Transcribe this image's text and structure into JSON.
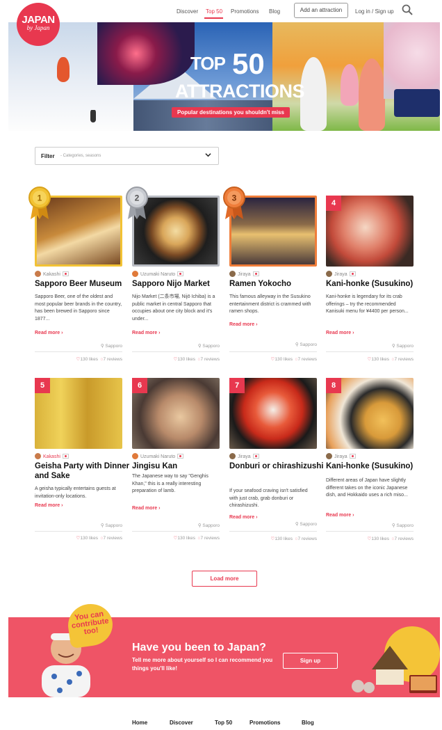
{
  "header": {
    "logo_line1": "JAPAN",
    "logo_line2": "by Japan",
    "nav": [
      "Discover",
      "Top 50",
      "Promotions",
      "Blog"
    ],
    "active_nav": "Top 50",
    "add_attraction": "Add an attraction",
    "login": "Log in / Sign up",
    "search_icon": "search-icon"
  },
  "hero": {
    "title_top": "TOP",
    "title_num": "50",
    "title_main": "ATTRACTIONS",
    "tagline": "Popular destinations you shouldn't miss"
  },
  "filter": {
    "label": "Filter",
    "placeholder": "- Categories, seasons"
  },
  "cards": [
    {
      "rank": "1",
      "author": "Kakashi",
      "title": "Sapporo Beer Museum",
      "desc": "Sapporo Beer, one of the oldest and most popular beer brands in the country, has been brewed in Sapporo since 1877...",
      "more": "Read more",
      "location": "Sapporo",
      "likes": "130 likes",
      "reviews": "7 reviews"
    },
    {
      "rank": "2",
      "author": "Uzumaki Naruto",
      "title": "Sapporo Nijo Market",
      "desc": "Nijo Market (二条市場, Nijō Ichiba) is a public market in central Sapporo that occupies about one city block and it's under...",
      "more": "Read more",
      "location": "Sapporo",
      "likes": "130 likes",
      "reviews": "7 reviews"
    },
    {
      "rank": "3",
      "author": "Jiraya",
      "title": "Ramen Yokocho",
      "desc": "This famous alleyway in the Susukino entertainment district is crammed with ramen shops.",
      "more": "Read more",
      "location": "Sapporo",
      "likes": "130 likes",
      "reviews": "7 reviews"
    },
    {
      "rank": "4",
      "author": "Jiraya",
      "title": "Kani-honke (Susukino)",
      "desc": "Kani-honke is legendary for its crab offerings – try the recommended Kanisuki menu for ¥4400 per person...",
      "more": "Read more",
      "location": "Sapporo",
      "likes": "130 likes",
      "reviews": "7 reviews"
    },
    {
      "rank": "5",
      "author": "Kakashi",
      "title": "Geisha Party with Dinner and Sake",
      "desc": "A geisha typically entertains guests at invitation-only locations.",
      "more": "Read more",
      "location": "Sapporo",
      "likes": "130 likes",
      "reviews": "7 reviews"
    },
    {
      "rank": "6",
      "author": "Uzumaki Naruto",
      "title": "Jingisu Kan",
      "desc": "The Japanese way to say \"Genghis Khan,\" this is a really interesting preparation of lamb.",
      "more": "Read more",
      "location": "Sapporo",
      "likes": "130 likes",
      "reviews": "7 reviews"
    },
    {
      "rank": "7",
      "author": "Jiraya",
      "title": "Donburi or chirashizushi",
      "desc": "If your seafood craving isn't satisfied with just crab, grab donburi or chirashizushi.",
      "more": "Read more",
      "location": "Sapporo",
      "likes": "130 likes",
      "reviews": "7 reviews"
    },
    {
      "rank": "8",
      "author": "Jiraya",
      "title": "Kani-honke (Susukino)",
      "desc": "Different areas of Japan have slightly different takes on the iconic Japanese dish, and Hokkaido uses a rich miso...",
      "more": "Read more",
      "location": "Sapporo",
      "likes": "130 likes",
      "reviews": "7 reviews"
    }
  ],
  "load_more": "Load more",
  "banner": {
    "bubble": "You can contribute too!",
    "title": "Have you been to Japan?",
    "text": "Tell me more about yourself so I can recommend you things you'll like!",
    "button": "Sign up"
  },
  "footer": [
    "Home",
    "Discover",
    "Top 50",
    "Promotions",
    "Blog"
  ],
  "colors": {
    "accent": "#e8384f",
    "gold": "#f2c234",
    "silver": "#b9bcc3",
    "bronze": "#ef7d3a"
  }
}
